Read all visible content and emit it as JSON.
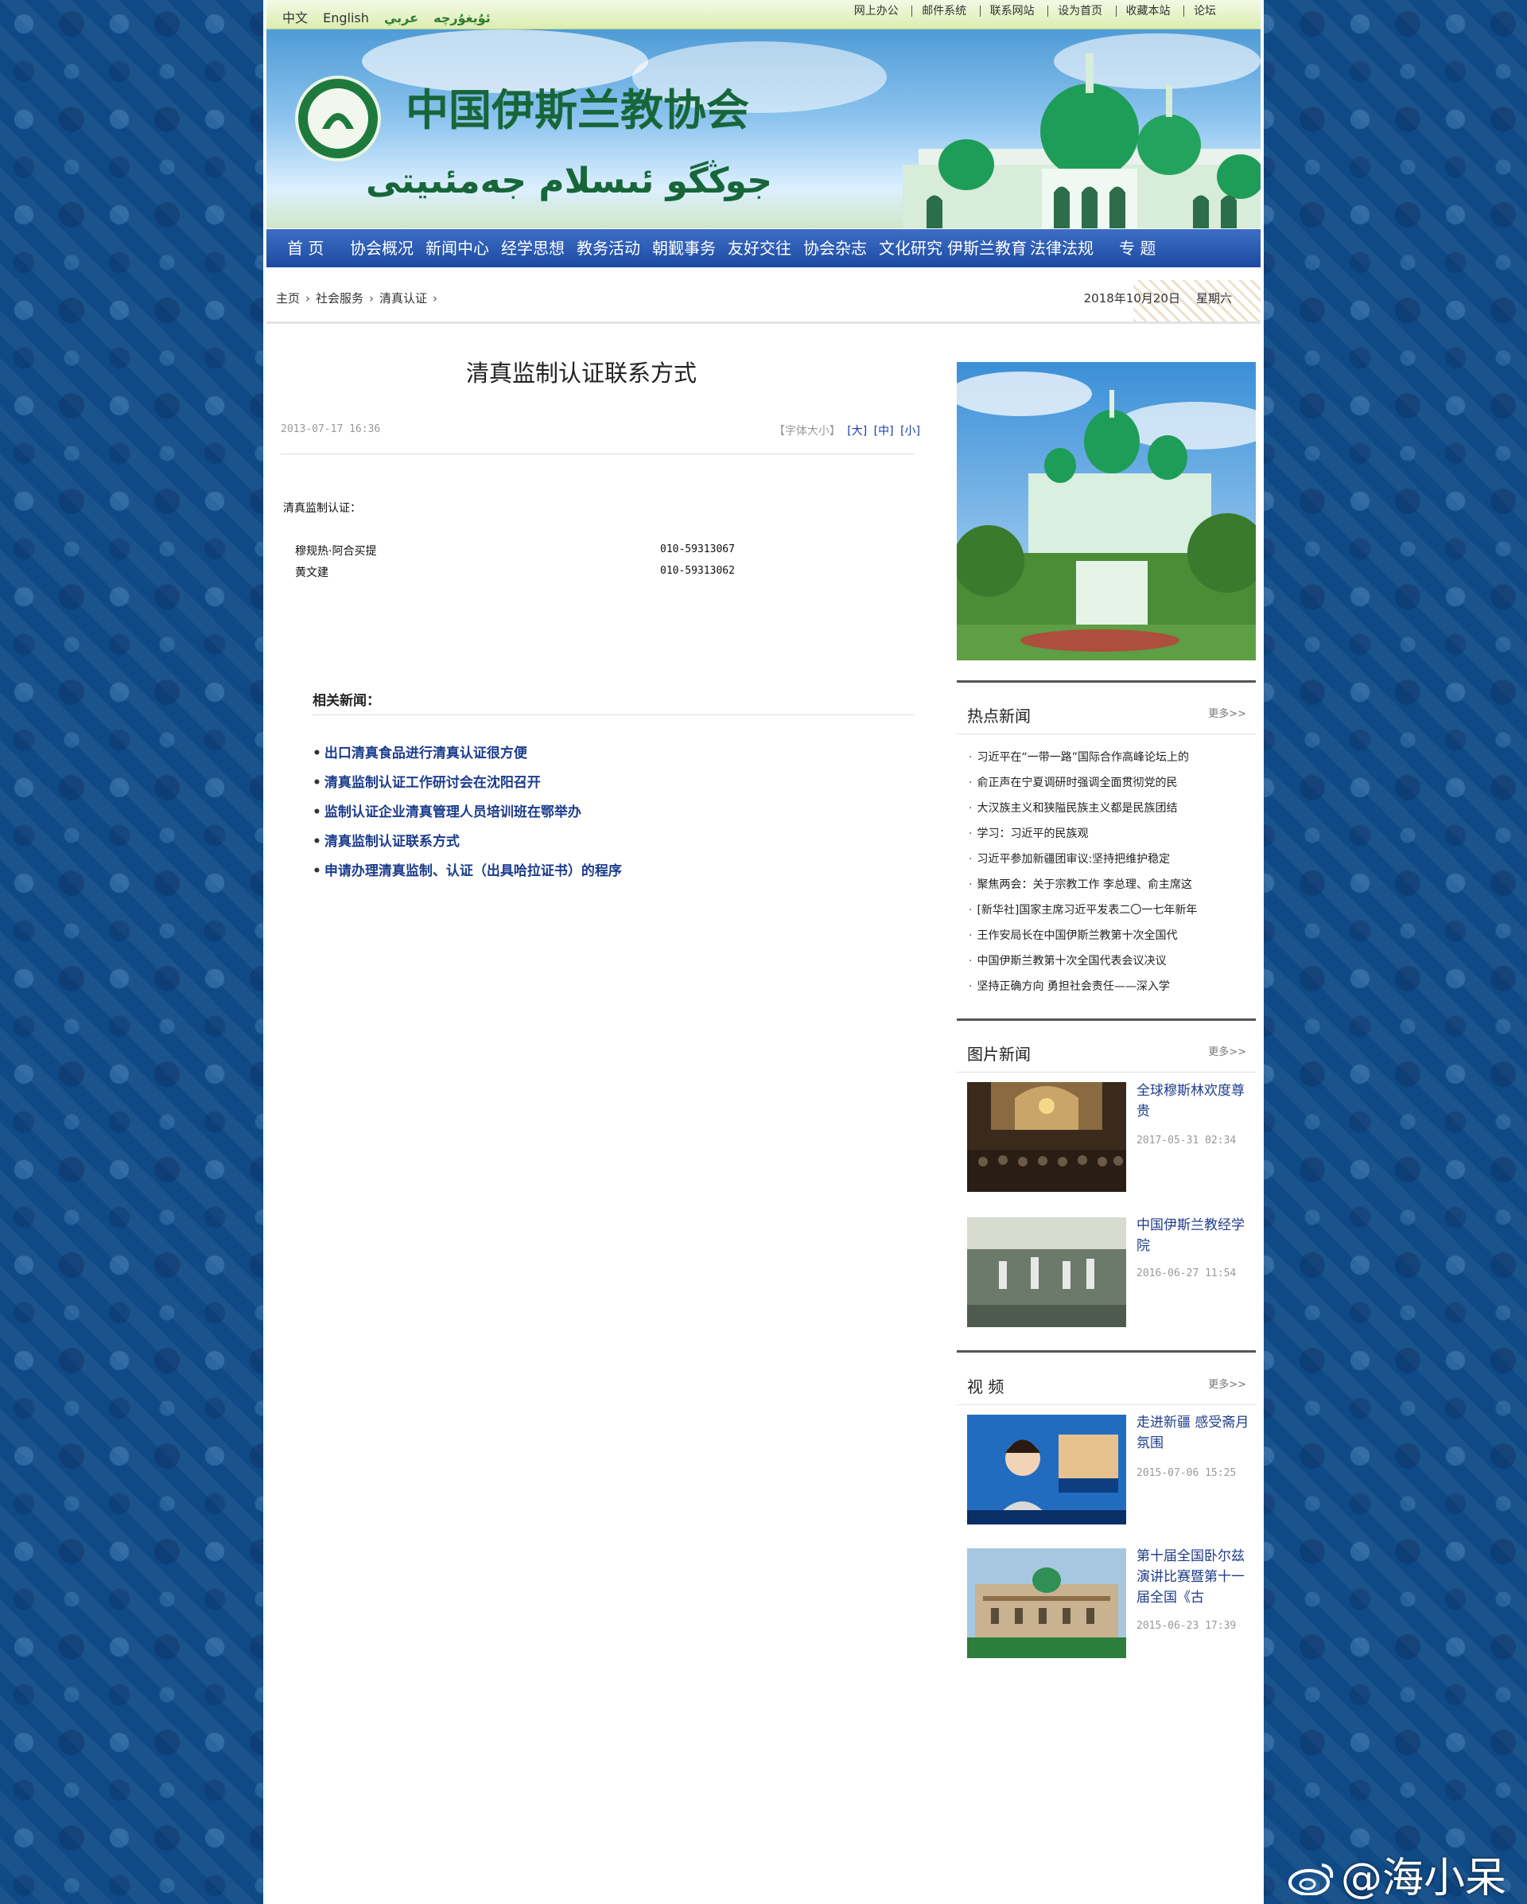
{
  "top_bar": {
    "languages": [
      "中文",
      "English",
      "ئۇيغۇرچە",
      "عربي"
    ],
    "links": [
      "网上办公",
      "邮件系统",
      "联系网站",
      "设为首页",
      "收藏本站",
      "论坛"
    ]
  },
  "banner": {
    "title_cn": "中国伊斯兰教协会",
    "title_ug": "جوڭگو ئىسلام جەمئىيتى"
  },
  "nav": [
    "首 页",
    "协会概况",
    "新闻中心",
    "经学思想",
    "教务活动",
    "朝觐事务",
    "友好交往",
    "协会杂志",
    "文化研究",
    "伊斯兰教育",
    "法律法规",
    "专 题"
  ],
  "breadcrumb": [
    "主页",
    "社会服务",
    "清真认证"
  ],
  "date": {
    "date": "2018年10月20日",
    "weekday": "星期六"
  },
  "article": {
    "title": "清真监制认证联系方式",
    "datetime": "2013-07-17 16:36",
    "font_size_label": "【字体大小】",
    "font_sizes": [
      "[大]",
      "[中]",
      "[小]"
    ],
    "intro": "清真监制认证：",
    "contacts": [
      {
        "name": "穆规热·阿合买提",
        "phone": "010-59313067"
      },
      {
        "name": "黄文建",
        "phone": "010-59313062"
      }
    ]
  },
  "related": {
    "title": "相关新闻：",
    "items": [
      "出口清真食品进行清真认证很方便",
      "清真监制认证工作研讨会在沈阳召开",
      "监制认证企业清真管理人员培训班在鄂举办",
      "清真监制认证联系方式",
      "申请办理清真监制、认证（出具哈拉证书）的程序"
    ]
  },
  "sidebar": {
    "hot_news": {
      "title": "热点新闻",
      "more": "更多>>",
      "items": [
        "习近平在“一带一路”国际合作高峰论坛上的",
        "俞正声在宁夏调研时强调全面贯彻党的民",
        "大汉族主义和狭隘民族主义都是民族团结",
        "学习：习近平的民族观",
        "习近平参加新疆团审议:坚持把维护稳定",
        "聚焦两会：关于宗教工作 李总理、俞主席这",
        "[新华社]国家主席习近平发表二〇一七年新年",
        "王作安局长在中国伊斯兰教第十次全国代",
        "中国伊斯兰教第十次全国代表会议决议",
        "坚持正确方向 勇担社会责任——深入学"
      ]
    },
    "photo_news": {
      "title": "图片新闻",
      "more": "更多>>",
      "items": [
        {
          "title": "全球穆斯林欢度尊贵",
          "date": "2017-05-31 02:34"
        },
        {
          "title": "中国伊斯兰教经学院",
          "date": "2016-06-27 11:54"
        }
      ]
    },
    "video": {
      "title": "视 频",
      "more": "更多>>",
      "items": [
        {
          "title": "走进新疆 感受斋月氛围",
          "date": "2015-07-06 15:25"
        },
        {
          "title": "第十届全国卧尔兹演讲比赛暨第十一届全国《古",
          "date": "2015-06-23 17:39"
        }
      ]
    }
  },
  "watermark": "@海小呆"
}
